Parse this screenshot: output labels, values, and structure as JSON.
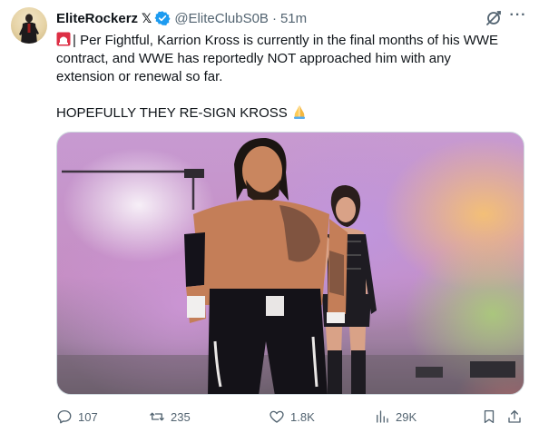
{
  "tweet": {
    "author_name": "EliteRockerz",
    "author_badge": "𝕏",
    "handle": "@EliteClubS0B",
    "separator": "·",
    "time": "51m",
    "body_lines": [
      "| Per Fightful, Karrion Kross is currently in the final months of his WWE",
      "contract, and WWE has reportedly NOT approached him with any",
      "extension or renewal so far."
    ],
    "body_line2": "HOPEFULLY THEY RE-SIGN KROSS",
    "leading_emoji": "siren-emoji",
    "trailing_emoji": "praying-hands-emoji",
    "media_alt": "Photo of wrestlers walking on stage",
    "more_label": "···",
    "stats": {
      "replies": "107",
      "reposts": "235",
      "likes": "1.8K",
      "views": "29K"
    }
  },
  "icons": {
    "verified": "verified-badge-icon",
    "grok": "grok-icon",
    "more": "more-options-icon",
    "reply": "reply-icon",
    "repost": "repost-icon",
    "like": "heart-icon",
    "views": "views-chart-icon",
    "bookmark": "bookmark-icon",
    "share": "share-icon"
  },
  "colors": {
    "text_primary": "#0f1419",
    "text_secondary": "#536471",
    "verified_blue": "#1d9bf0",
    "border": "#cfd9de"
  }
}
